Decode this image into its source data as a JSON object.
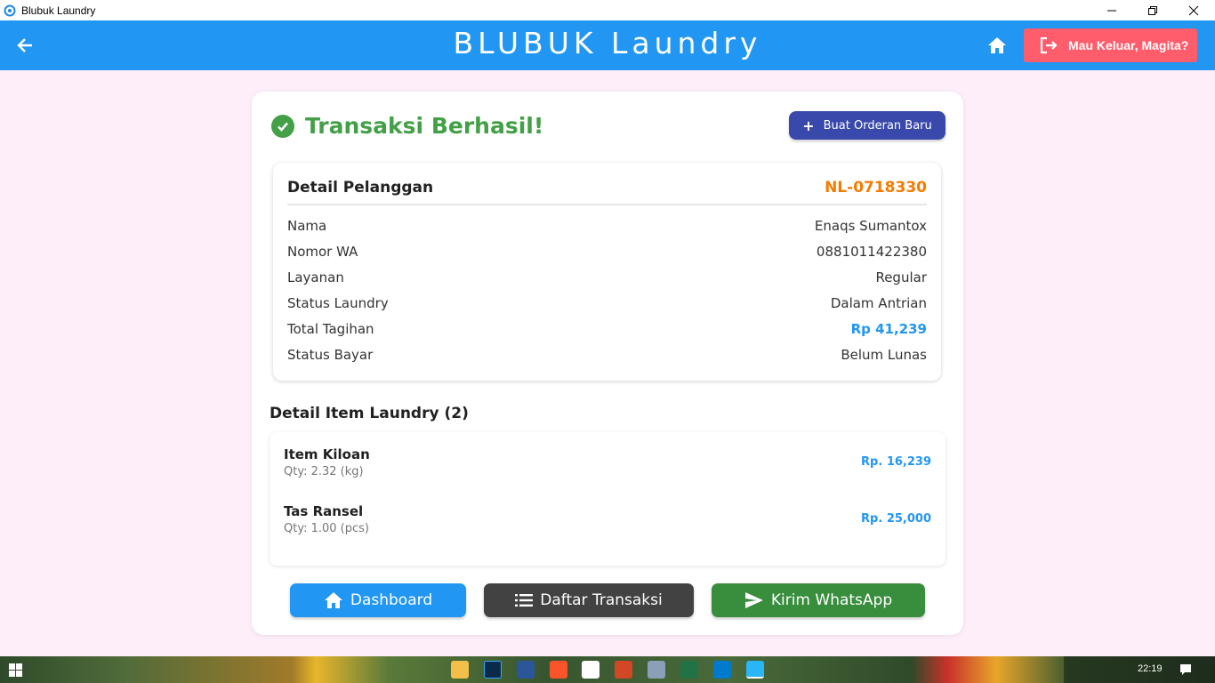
{
  "window": {
    "title": "Blubuk Laundry"
  },
  "appbar": {
    "brand": "BLUBUK Laundry",
    "logout_label": "Mau Keluar, Magita?"
  },
  "success": {
    "title": "Transaksi Berhasil!",
    "new_order_label": "Buat Orderan Baru"
  },
  "customer": {
    "heading": "Detail Pelanggan",
    "code": "NL-0718330",
    "rows": [
      {
        "label": "Nama",
        "value": "Enaqs Sumantox"
      },
      {
        "label": "Nomor WA",
        "value": "0881011422380"
      },
      {
        "label": "Layanan",
        "value": "Regular"
      },
      {
        "label": "Status Laundry",
        "value": "Dalam Antrian"
      },
      {
        "label": "Total Tagihan",
        "value": "Rp 41,239"
      },
      {
        "label": "Status Bayar",
        "value": "Belum Lunas"
      }
    ]
  },
  "items": {
    "heading": "Detail Item Laundry (2)",
    "list": [
      {
        "name": "Item Kiloan",
        "qty": "Qty: 2.32 (kg)",
        "price": "Rp. 16,239"
      },
      {
        "name": "Tas Ransel",
        "qty": "Qty: 1.00 (pcs)",
        "price": "Rp. 25,000"
      }
    ]
  },
  "actions": {
    "dashboard": "Dashboard",
    "transactions": "Daftar Transaksi",
    "whatsapp": "Kirim WhatsApp"
  },
  "taskbar": {
    "time": "22:19"
  },
  "colors": {
    "appbar": "#2196f3",
    "logout": "#ff5c6c",
    "success": "#43a047",
    "order_code": "#f57c00",
    "new_order": "#3949ab",
    "whatsapp": "#388e3c"
  }
}
